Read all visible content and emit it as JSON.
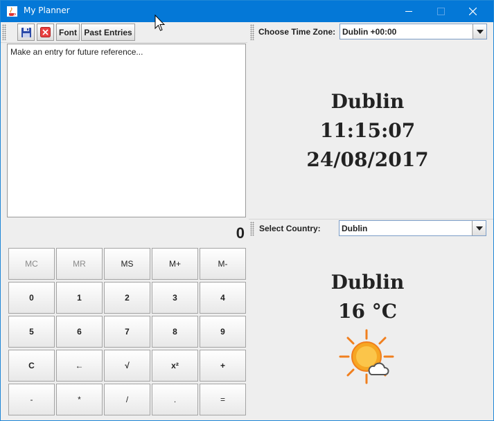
{
  "window": {
    "title": "My Planner",
    "accent_color": "#0478d7"
  },
  "toolbar": {
    "save_icon": "floppy-disk-icon",
    "delete_icon": "red-x-icon",
    "font_label": "Font",
    "past_entries_label": "Past Entries"
  },
  "editor": {
    "placeholder": "Make an entry for future reference..."
  },
  "calculator": {
    "display": "0",
    "rows": [
      [
        "MC",
        "MR",
        "MS",
        "M+",
        "M-"
      ],
      [
        "0",
        "1",
        "2",
        "3",
        "4"
      ],
      [
        "5",
        "6",
        "7",
        "8",
        "9"
      ],
      [
        "C",
        "←",
        "√",
        "x²",
        "+"
      ],
      [
        "-",
        "*",
        "/",
        ".",
        "="
      ]
    ]
  },
  "timezone": {
    "label": "Choose Time Zone:",
    "selected": "Dublin +00:00"
  },
  "clock": {
    "city": "Dublin",
    "time": "11:15:07",
    "date": "24/08/2017"
  },
  "country": {
    "label": "Select Country:",
    "selected": "Dublin"
  },
  "weather": {
    "city": "Dublin",
    "temperature": "16 °C",
    "icon": "sun-behind-cloud-icon"
  }
}
